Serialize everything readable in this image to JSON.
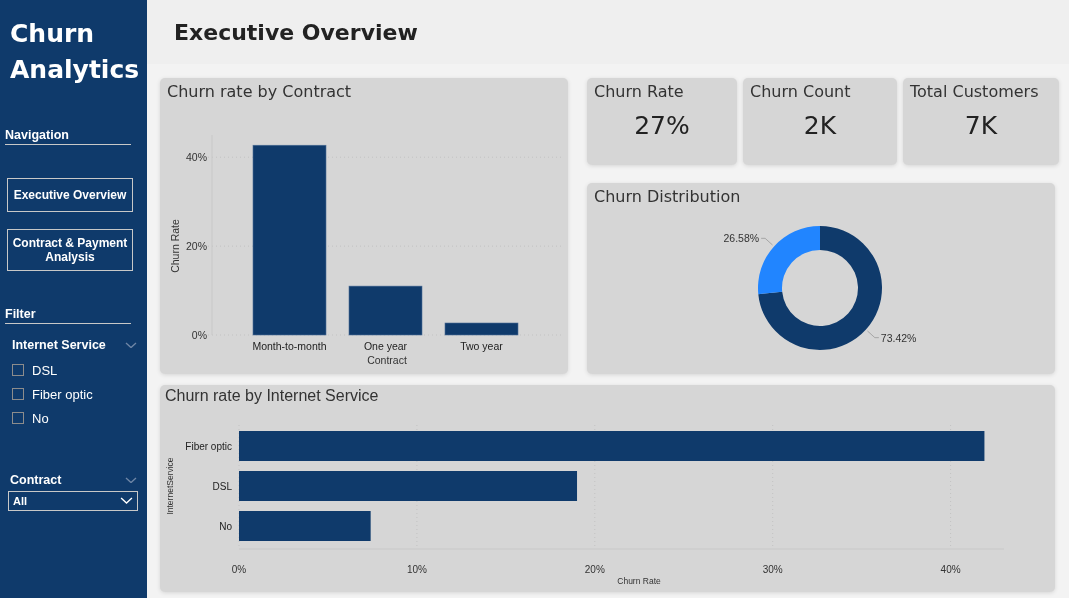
{
  "sidebar": {
    "title": "Churn Analytics",
    "navigation_label": "Navigation",
    "nav_buttons": [
      {
        "label": "Executive Overview"
      },
      {
        "label": "Contract & Payment Analysis"
      }
    ],
    "filter_label": "Filter",
    "internet_service_filter": {
      "label": "Internet Service",
      "options": [
        {
          "label": "DSL",
          "checked": false
        },
        {
          "label": "Fiber optic",
          "checked": false
        },
        {
          "label": "No",
          "checked": false
        }
      ]
    },
    "contract_filter": {
      "label": "Contract",
      "value": "All"
    }
  },
  "page_title": "Executive Overview",
  "contract_chart": {
    "chart_data": {
      "type": "bar",
      "title": "Churn rate by Contract",
      "xlabel": "Contract",
      "ylabel": "Churn Rate",
      "categories": [
        "Month-to-month",
        "One year",
        "Two year"
      ],
      "values": [
        0.427,
        0.11,
        0.027
      ],
      "grid": true,
      "ylim": [
        0,
        0.45
      ],
      "yticks": [
        {
          "value": 0,
          "label": "0%"
        },
        {
          "value": 0.2,
          "label": "20%"
        },
        {
          "value": 0.4,
          "label": "40%"
        }
      ]
    }
  },
  "kpis": [
    {
      "label": "Churn Rate",
      "value": "27%"
    },
    {
      "label": "Churn Count",
      "value": "2K"
    },
    {
      "label": "Total Customers",
      "value": "7K"
    }
  ],
  "distribution_chart": {
    "chart_data": {
      "type": "donut",
      "title": "Churn Distribution",
      "values": [
        73.42,
        26.58
      ],
      "value_labels": [
        "73.42%",
        "26.58%"
      ]
    }
  },
  "internet_chart": {
    "chart_data": {
      "type": "bar",
      "orientation": "horizontal",
      "title": "Churn rate by Internet Service",
      "xlabel": "Churn Rate",
      "ylabel": "InternetService",
      "categories": [
        "Fiber optic",
        "DSL",
        "No"
      ],
      "values": [
        0.419,
        0.19,
        0.074
      ],
      "grid": true,
      "xlim": [
        0,
        0.43
      ],
      "xticks": [
        {
          "value": 0,
          "label": "0%"
        },
        {
          "value": 0.1,
          "label": "10%"
        },
        {
          "value": 0.2,
          "label": "20%"
        },
        {
          "value": 0.3,
          "label": "30%"
        },
        {
          "value": 0.4,
          "label": "40%"
        }
      ]
    }
  }
}
